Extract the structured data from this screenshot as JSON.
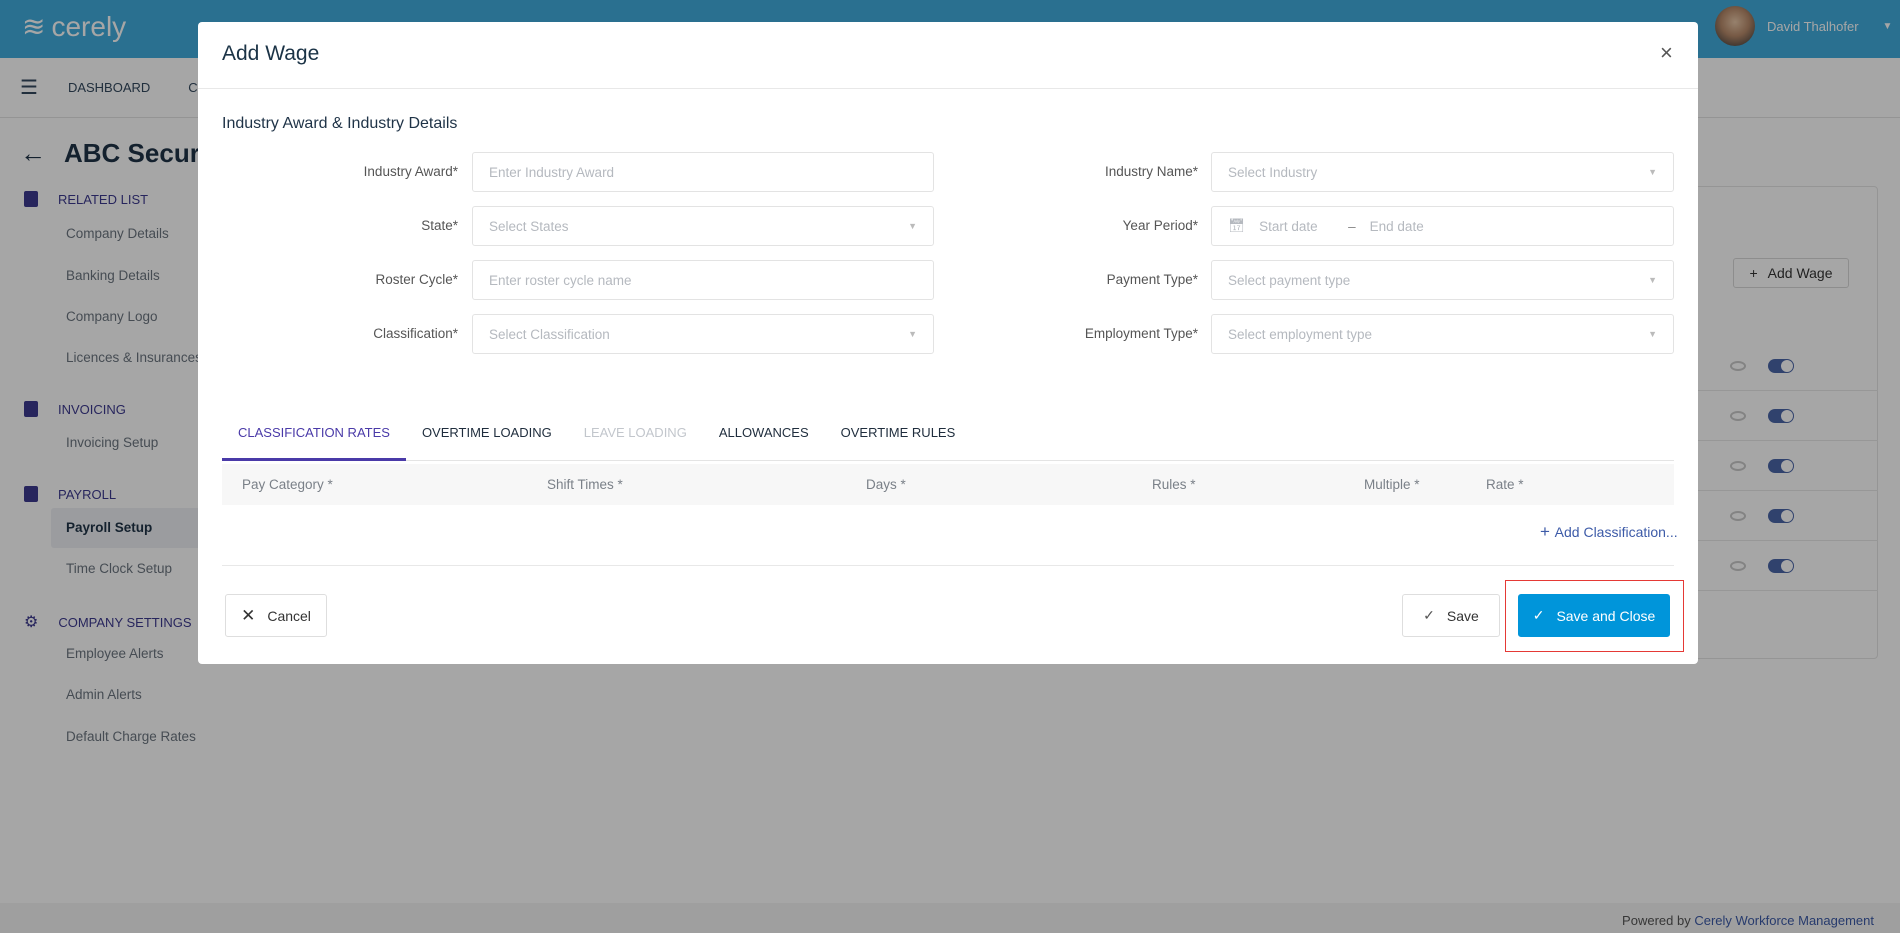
{
  "app": {
    "logo": "cerely",
    "user_name": "David Thalhofer"
  },
  "nav": {
    "items": [
      "DASHBOARD",
      "CL"
    ]
  },
  "page": {
    "title": "ABC Security"
  },
  "sidebar": {
    "sections": [
      {
        "title": "RELATED LIST",
        "icon": "bookmark-icon",
        "items": [
          "Company Details",
          "Banking Details",
          "Company Logo",
          "Licences & Insurances"
        ]
      },
      {
        "title": "INVOICING",
        "icon": "document-icon",
        "items": [
          "Invoicing Setup"
        ]
      },
      {
        "title": "PAYROLL",
        "icon": "documents-icon",
        "items": [
          "Payroll Setup",
          "Time Clock Setup"
        ]
      },
      {
        "title": "COMPANY SETTINGS",
        "icon": "gear-icon",
        "items": [
          "Employee Alerts",
          "Admin Alerts",
          "Default Charge Rates"
        ]
      }
    ],
    "active": "Payroll Setup"
  },
  "background": {
    "add_wage_label": "Add Wage",
    "row_count": 5,
    "toggles_on": true
  },
  "footer": {
    "prefix": "Powered by",
    "link": "Cerely Workforce Management"
  },
  "modal": {
    "title": "Add Wage",
    "close": "×",
    "section_title": "Industry Award & Industry Details",
    "left_fields": [
      {
        "label": "Industry Award",
        "placeholder": "Enter Industry Award",
        "type": "text"
      },
      {
        "label": "State",
        "placeholder": "Select States",
        "type": "select"
      },
      {
        "label": "Roster Cycle",
        "placeholder": "Enter roster cycle name",
        "type": "text"
      },
      {
        "label": "Classification",
        "placeholder": "Select Classification",
        "type": "select"
      }
    ],
    "right_fields": [
      {
        "label": "Industry Name",
        "placeholder": "Select Industry",
        "type": "select"
      },
      {
        "label": "Year Period",
        "start_placeholder": "Start date",
        "end_placeholder": "End date",
        "separator": "–",
        "type": "daterange"
      },
      {
        "label": "Payment Type",
        "placeholder": "Select payment type",
        "type": "select"
      },
      {
        "label": "Employment Type",
        "placeholder": "Select employment type",
        "type": "select"
      }
    ],
    "required_mark": "*",
    "tabs": [
      {
        "label": "CLASSIFICATION RATES",
        "state": "active"
      },
      {
        "label": "OVERTIME LOADING",
        "state": "normal"
      },
      {
        "label": "LEAVE LOADING",
        "state": "disabled"
      },
      {
        "label": "ALLOWANCES",
        "state": "normal"
      },
      {
        "label": "OVERTIME RULES",
        "state": "normal"
      }
    ],
    "columns": [
      "Pay Category *",
      "Shift Times *",
      "Days *",
      "Rules *",
      "Multiple *",
      "Rate *"
    ],
    "add_classification": "Add Classification...",
    "cancel_label": "Cancel",
    "save_label": "Save",
    "save_close_label": "Save and Close"
  },
  "colors": {
    "primary": "#0095da",
    "accent": "#4a3aa8",
    "header": "#41acdd",
    "highlight": "#e53935"
  }
}
